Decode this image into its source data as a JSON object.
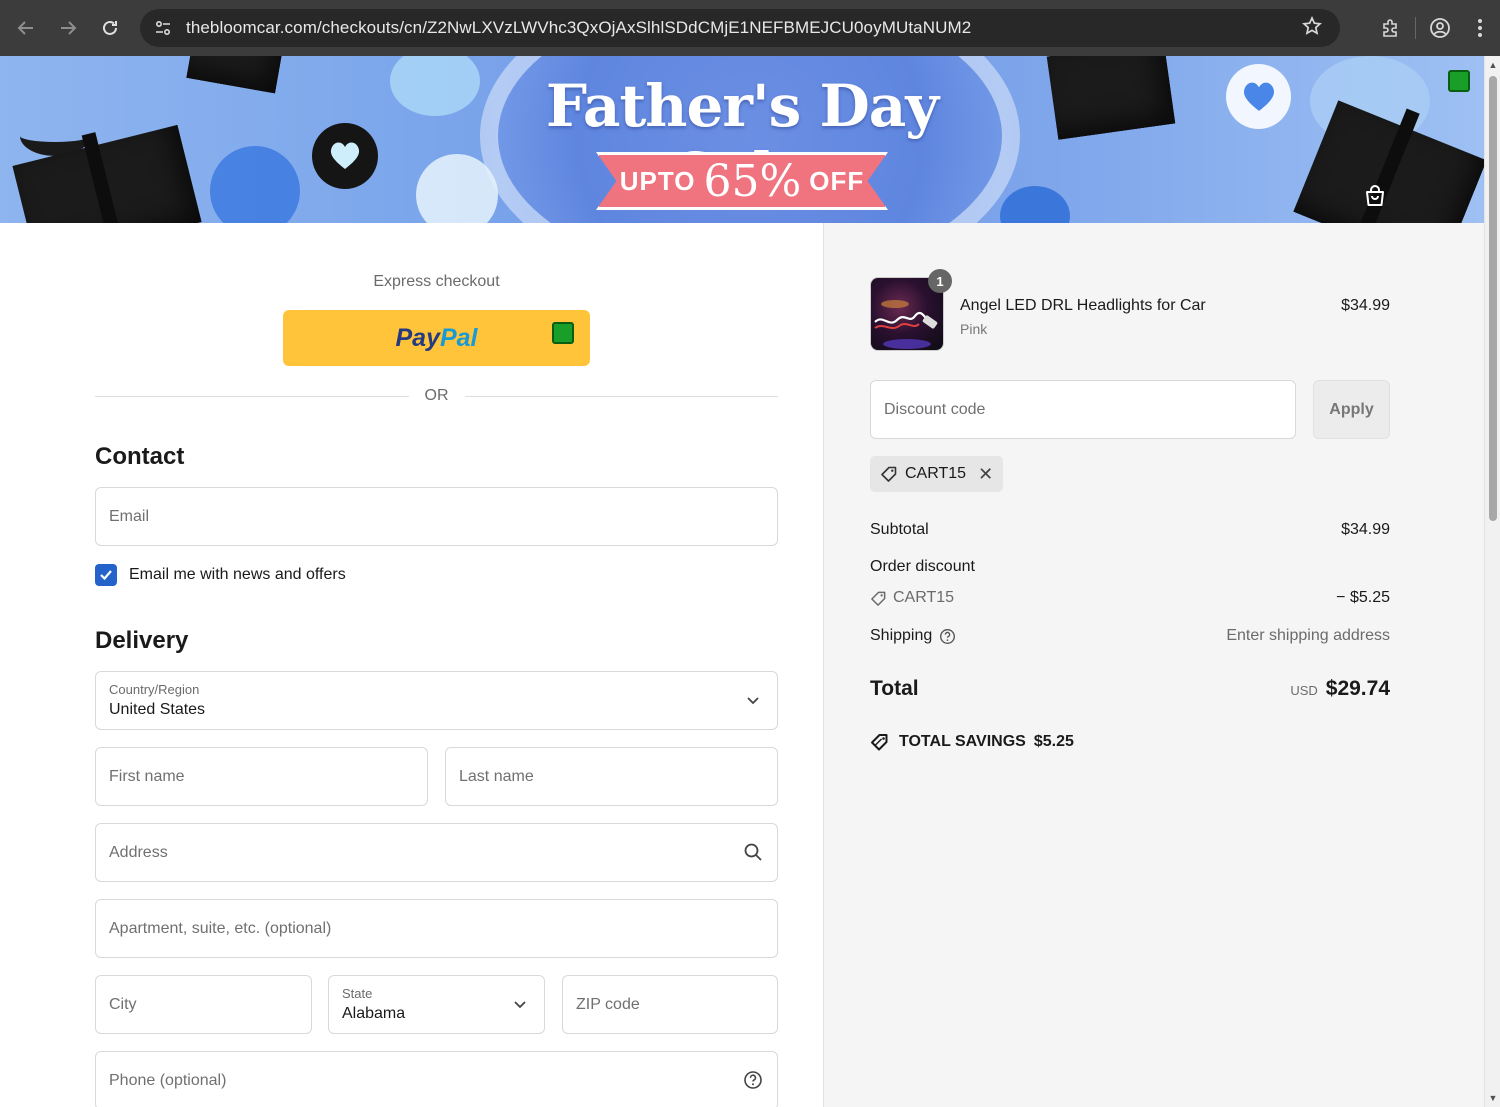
{
  "browser": {
    "url": "thebloomcar.com/checkouts/cn/Z2NwLXVzLWVhc3QxOjAxSlhlSDdCMjE1NEFBMEJCU0oyMUtaNUM2",
    "icons": [
      "back-icon",
      "forward-icon",
      "reload-icon",
      "site-info-icon",
      "star-icon",
      "extensions-icon",
      "profile-icon",
      "menu-icon"
    ]
  },
  "banner": {
    "title": "Father's Day Sale",
    "upto": "UPTO",
    "percent": "65%",
    "off": "OFF"
  },
  "express": {
    "label": "Express checkout",
    "paypal_pay": "Pay",
    "paypal_pal": "Pal",
    "or": "OR"
  },
  "contact": {
    "title": "Contact",
    "email_placeholder": "Email",
    "newsletter_label": "Email me with news and offers",
    "newsletter_checked": true
  },
  "delivery": {
    "title": "Delivery",
    "country_label": "Country/Region",
    "country_value": "United States",
    "first_name_placeholder": "First name",
    "last_name_placeholder": "Last name",
    "address_placeholder": "Address",
    "apartment_placeholder": "Apartment, suite, etc. (optional)",
    "city_placeholder": "City",
    "state_label": "State",
    "state_value": "Alabama",
    "zip_placeholder": "ZIP code",
    "phone_placeholder": "Phone (optional)"
  },
  "order": {
    "product": {
      "name": "Angel LED DRL Headlights for Car",
      "variant": "Pink",
      "price": "$34.99",
      "quantity": "1"
    },
    "discount_placeholder": "Discount code",
    "apply_label": "Apply",
    "applied_code": "CART15",
    "subtotal_label": "Subtotal",
    "subtotal_value": "$34.99",
    "order_discount_label": "Order discount",
    "discount_code": "CART15",
    "discount_value": "− $5.25",
    "shipping_label": "Shipping",
    "shipping_value": "Enter shipping address",
    "total_label": "Total",
    "total_currency": "USD",
    "total_value": "$29.74",
    "savings_label": "TOTAL SAVINGS",
    "savings_value": "$5.25"
  },
  "colors": {
    "paypal_yellow": "#ffc439",
    "checkbox_blue": "#2463c9",
    "banner_blue": "#7ea8ec",
    "ribbon_pink": "#ef7480"
  }
}
